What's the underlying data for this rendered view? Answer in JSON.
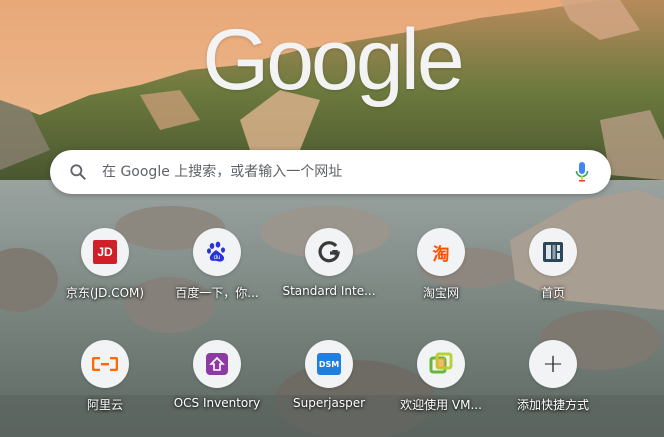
{
  "logo_text": "Google",
  "search": {
    "placeholder": "在 Google 上搜索，或者输入一个网址",
    "search_icon": "search-icon",
    "mic_icon": "microphone-icon"
  },
  "shortcuts": [
    {
      "label": "京东(JD.COM)",
      "icon": "jd-icon",
      "icon_text": "JD"
    },
    {
      "label": "百度一下，你...",
      "icon": "baidu-paw-icon",
      "icon_text": "du"
    },
    {
      "label": "Standard Inte...",
      "icon": "g-logo-icon",
      "icon_text": ""
    },
    {
      "label": "淘宝网",
      "icon": "taobao-icon",
      "icon_text": "淘"
    },
    {
      "label": "首页",
      "icon": "page-icon",
      "icon_text": ""
    },
    {
      "label": "阿里云",
      "icon": "aliyun-icon",
      "icon_text": ""
    },
    {
      "label": "OCS Inventory",
      "icon": "ocs-icon",
      "icon_text": ""
    },
    {
      "label": "Superjasper",
      "icon": "dsm-icon",
      "icon_text": "DSM"
    },
    {
      "label": "欢迎使用 VM...",
      "icon": "vmware-icon",
      "icon_text": ""
    },
    {
      "label": "添加快捷方式",
      "icon": "plus-icon",
      "icon_text": "+"
    }
  ],
  "colors": {
    "jd_red": "#d11f2a",
    "baidu_blue": "#2932e1",
    "taobao_orange": "#ff5000",
    "aliyun_orange": "#ff6a00",
    "ocs_purple": "#8e3aa5",
    "dsm_blue": "#1f7fe0",
    "mic_blue": "#4285f4",
    "mic_red": "#ea4335"
  }
}
